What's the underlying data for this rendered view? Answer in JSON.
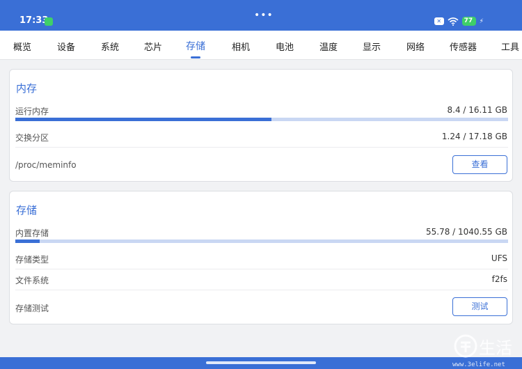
{
  "status_bar": {
    "time": "17:33",
    "battery": "77",
    "dots": "•••"
  },
  "tabs": [
    {
      "label": "概览"
    },
    {
      "label": "设备"
    },
    {
      "label": "系统"
    },
    {
      "label": "芯片"
    },
    {
      "label": "存储",
      "active": true
    },
    {
      "label": "相机"
    },
    {
      "label": "电池"
    },
    {
      "label": "温度"
    },
    {
      "label": "显示"
    },
    {
      "label": "网络"
    },
    {
      "label": "传感器"
    },
    {
      "label": "工具"
    }
  ],
  "memory": {
    "title": "内存",
    "ram_label": "运行内存",
    "ram_value": "8.4 / 16.11 GB",
    "ram_usage_fraction": 0.52,
    "swap_label": "交换分区",
    "swap_value": "1.24 / 17.18 GB",
    "meminfo_label": "/proc/meminfo",
    "view_button": "查看"
  },
  "storage": {
    "title": "存储",
    "internal_label": "内置存储",
    "internal_value": "55.78 / 1040.55 GB",
    "internal_usage_fraction": 0.05,
    "type_label": "存储类型",
    "type_value": "UFS",
    "fs_label": "文件系统",
    "fs_value": "f2fs",
    "test_label": "存储测试",
    "test_button": "测试"
  },
  "watermark": {
    "text": "生活",
    "url": "www.3elife.net"
  },
  "colors": {
    "accent": "#3a6fd6",
    "track": "#c9d7f3",
    "battery": "#3fcf6a"
  }
}
